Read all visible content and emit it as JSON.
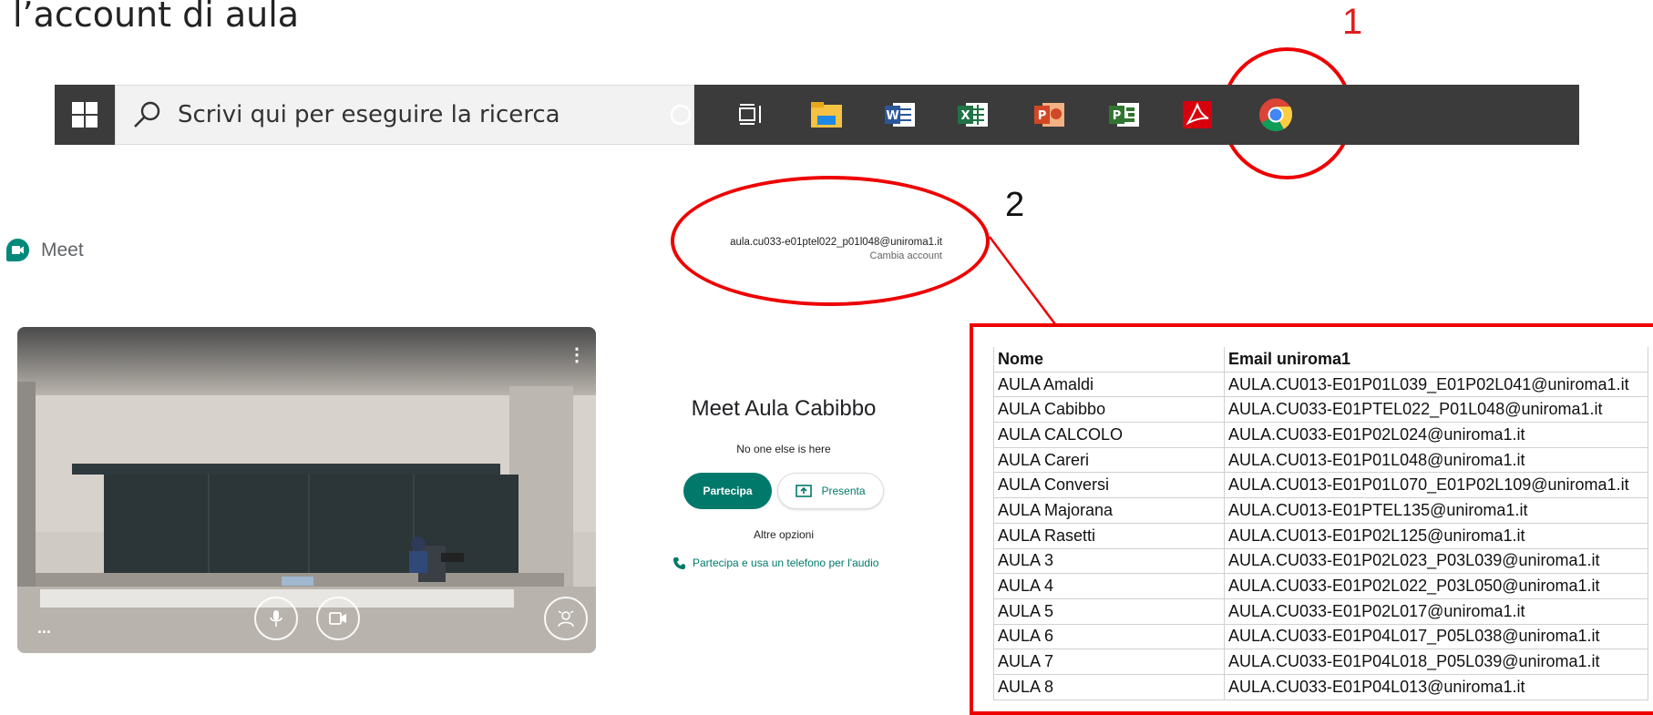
{
  "heading": "l’account di aula",
  "annotations": {
    "one": "1",
    "two": "2"
  },
  "taskbar": {
    "search_placeholder": "Scrivi qui per eseguire la ricerca",
    "icons": [
      "windows-start-icon",
      "search-icon",
      "cortana-icon",
      "task-view-icon",
      "file-explorer-icon",
      "word-icon",
      "excel-icon",
      "powerpoint-icon",
      "project-icon",
      "acrobat-icon",
      "chrome-icon"
    ]
  },
  "meet": {
    "logo_text": "Meet",
    "account_email": "aula.cu033-e01ptel022_p01l048@uniroma1.it",
    "switch_account": "Cambia account",
    "title": "Meet Aula Cabibbo",
    "no_one": "No one else is here",
    "join_label": "Partecipa",
    "present_label": "Presenta",
    "other_options": "Altre opzioni",
    "phone_label": "Partecipa e usa un telefono per l'audio",
    "more_label": "...",
    "menu_label": "⋮"
  },
  "table": {
    "headers": [
      "Nome",
      "Email uniroma1"
    ],
    "rows": [
      [
        "AULA Amaldi",
        "AULA.CU013-E01P01L039_E01P02L041@uniroma1.it"
      ],
      [
        "AULA Cabibbo",
        "AULA.CU033-E01PTEL022_P01L048@uniroma1.it"
      ],
      [
        "AULA CALCOLO",
        "AULA.CU033-E01P02L024@uniroma1.it"
      ],
      [
        "AULA Careri",
        "AULA.CU013-E01P01L048@uniroma1.it"
      ],
      [
        "AULA Conversi",
        "AULA.CU013-E01P01L070_E01P02L109@uniroma1.it"
      ],
      [
        "AULA Majorana",
        "AULA.CU013-E01PTEL135@uniroma1.it"
      ],
      [
        "AULA Rasetti",
        "AULA.CU013-E01P02L125@uniroma1.it"
      ],
      [
        "AULA 3",
        "AULA.CU033-E01P02L023_P03L039@uniroma1.it"
      ],
      [
        "AULA 4",
        "AULA.CU033-E01P02L022_P03L050@uniroma1.it"
      ],
      [
        "AULA 5",
        "AULA.CU033-E01P02L017@uniroma1.it"
      ],
      [
        "AULA 6",
        "AULA.CU033-E01P04L017_P05L038@uniroma1.it"
      ],
      [
        "AULA 7",
        "AULA.CU033-E01P04L018_P05L039@uniroma1.it"
      ],
      [
        "AULA 8",
        "AULA.CU033-E01P04L013@uniroma1.it"
      ]
    ]
  },
  "colors": {
    "annotation_red": "#e00000",
    "meet_teal": "#00796b",
    "taskbar": "#3b3b3b"
  }
}
